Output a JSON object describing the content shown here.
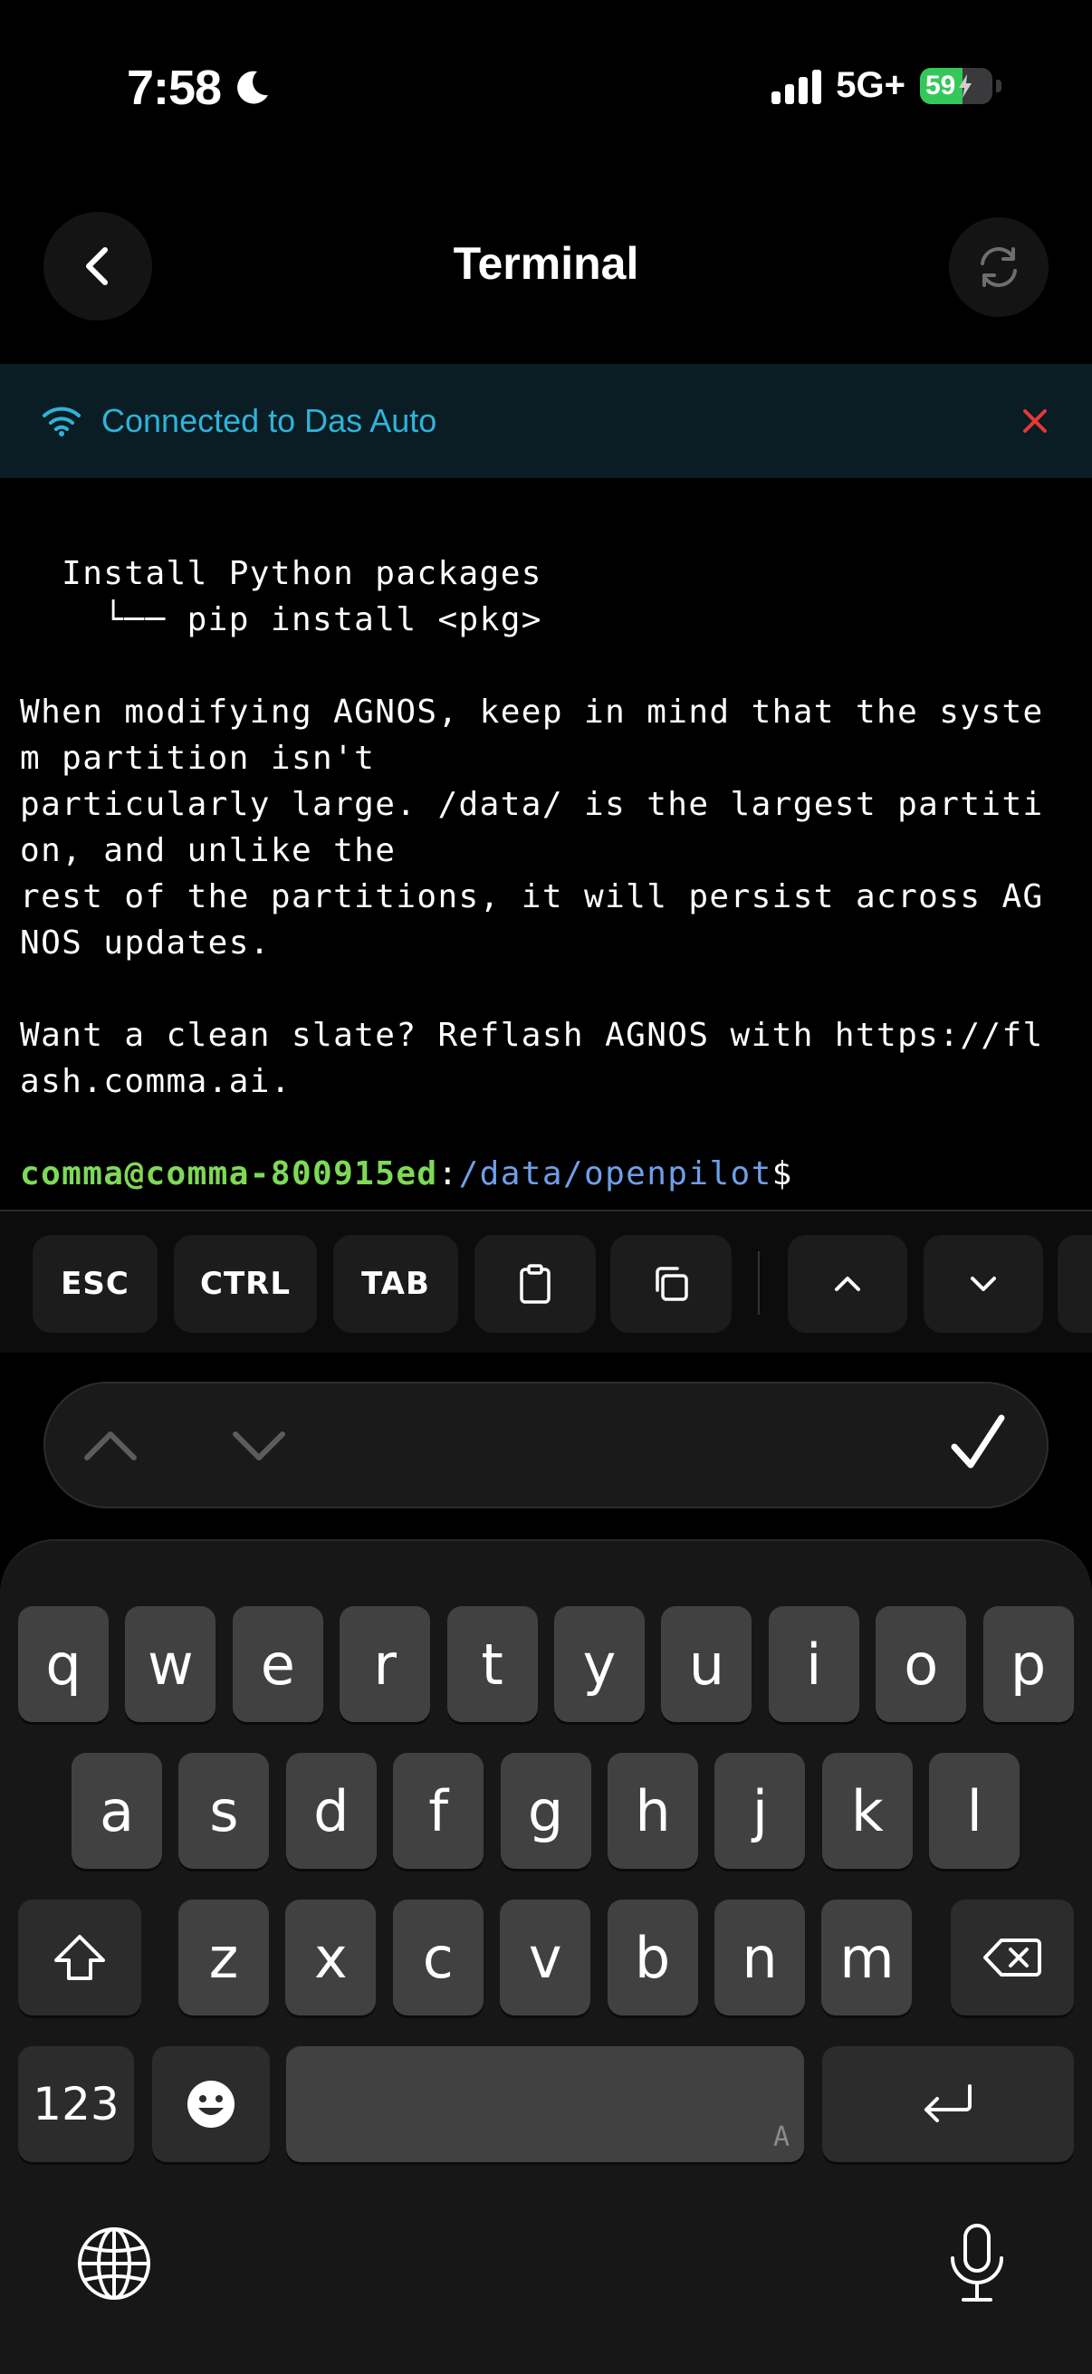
{
  "status_bar": {
    "time": "7:58",
    "network": "5G+",
    "battery_percent": "59",
    "battery_level": 0.59
  },
  "nav": {
    "title": "Terminal",
    "back_icon": "chevron-left-icon",
    "refresh_icon": "refresh-icon"
  },
  "connection": {
    "text": "Connected to Das Auto",
    "accent_color": "#2fb3d8",
    "close_color": "#e53935"
  },
  "terminal": {
    "lines": [
      "  Install Python packages",
      "    └── pip install <pkg>",
      "",
      "When modifying AGNOS, keep in mind that the syste",
      "m partition isn't",
      "particularly large. /data/ is the largest partiti",
      "on, and unlike the",
      "rest of the partitions, it will persist across AG",
      "NOS updates.",
      "",
      "Want a clean slate? Reflash AGNOS with https://fl",
      "ash.comma.ai.",
      ""
    ],
    "prompt_user": "comma@comma-800915ed",
    "prompt_sep": ":",
    "prompt_path": "/data/openpilot",
    "prompt_symbol": "$"
  },
  "toolbar": {
    "esc": "ESC",
    "ctrl": "CTRL",
    "tab": "TAB",
    "paste_icon": "clipboard-icon",
    "copy_icon": "copy-icon",
    "up_icon": "chevron-up-icon",
    "down_icon": "chevron-down-icon"
  },
  "keyboard": {
    "row1": [
      "q",
      "w",
      "e",
      "r",
      "t",
      "y",
      "u",
      "i",
      "o",
      "p"
    ],
    "row2": [
      "a",
      "s",
      "d",
      "f",
      "g",
      "h",
      "j",
      "k",
      "l"
    ],
    "row3": [
      "z",
      "x",
      "c",
      "v",
      "b",
      "n",
      "m"
    ],
    "numbers_key": "123",
    "space_hint": "A"
  }
}
